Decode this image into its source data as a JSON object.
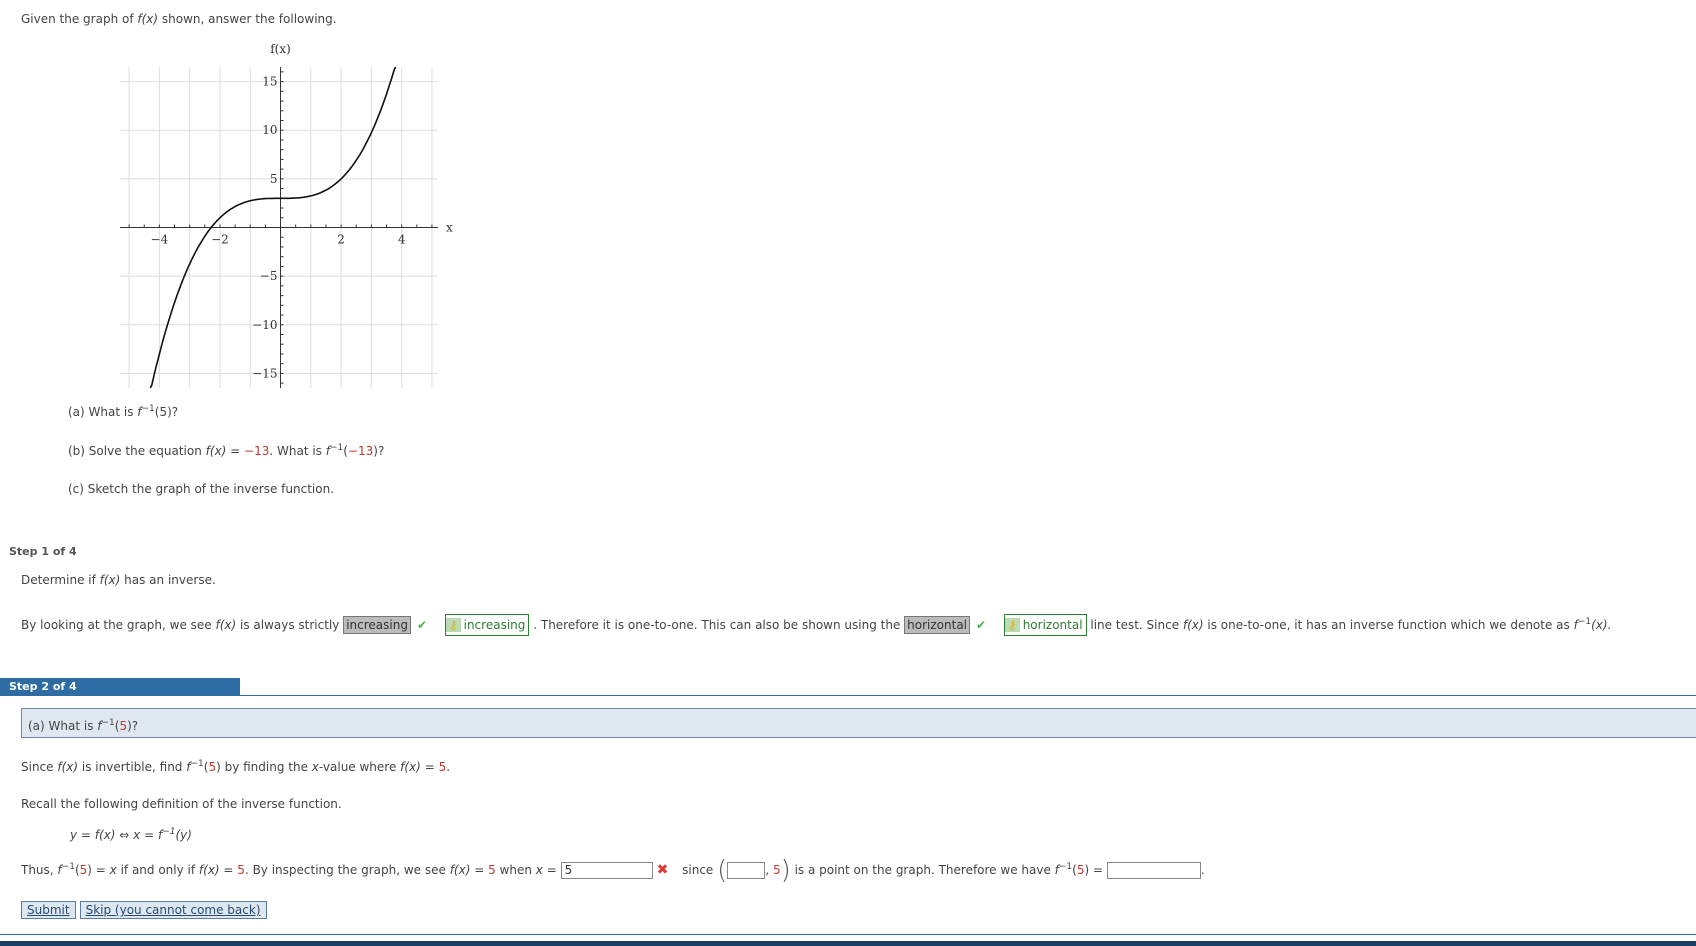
{
  "intro": {
    "pre": "Given the graph of ",
    "fx": "f(x)",
    "post": " shown, answer the following."
  },
  "chart_data": {
    "type": "line",
    "xlabel": "x",
    "ylabel": "f(x)",
    "xlim": [
      -5.3,
      5.2
    ],
    "ylim": [
      -16.5,
      16.5
    ],
    "x_ticks": [
      -4,
      -2,
      2,
      4
    ],
    "y_ticks": [
      -15,
      -10,
      -5,
      5,
      10,
      15
    ],
    "x_tick_labels": [
      "−4",
      "−2",
      "2",
      "4"
    ],
    "y_tick_labels": [
      "−15",
      "−10",
      "−5",
      "5",
      "10",
      "15"
    ],
    "grid": true,
    "series": [
      {
        "x": [
          -4.3,
          -4,
          -3,
          -2.3,
          -2,
          -1,
          0,
          1,
          2,
          3,
          3.8
        ],
        "y": [
          -16.9,
          -13,
          -3.75,
          0,
          1,
          2.75,
          3,
          3.25,
          5,
          9.75,
          16.7
        ]
      }
    ]
  },
  "questions": {
    "a": {
      "pre": "(a) What is ",
      "f": "f",
      "sup": "−1",
      "arg": "(5)?"
    },
    "b": {
      "pre": "(b) Solve the equation ",
      "fx": "f(x)",
      "eq": " = ",
      "val": "−13",
      "mid": ".  What is ",
      "f": "f",
      "sup": "−1",
      "arg_open": "(",
      "arg_val": "−13",
      "arg_close": ")?"
    },
    "c": {
      "text": "(c) Sketch the graph of the inverse function."
    }
  },
  "step1": {
    "label": "Step 1 of 4",
    "prompt_pre": "Determine if ",
    "prompt_fx": "f(x)",
    "prompt_post": " has an inverse.",
    "s_pre": "By looking at the graph, we see ",
    "s_fx": "f(x)",
    "s_mid": " is always strictly ",
    "answer1": "increasing",
    "key1": "increasing",
    "s_mid2": ". Therefore it is one-to-one. This can also be shown using the ",
    "answer2": "horizontal",
    "key2": "horizontal",
    "s_mid3": " line test. Since ",
    "s_fx2": "f(x)",
    "s_mid4": " is one-to-one, it has an inverse function which we denote as ",
    "s_f": "f",
    "s_sup": "−1",
    "s_end": "(x)."
  },
  "step2": {
    "label": "Step 2 of 4",
    "question": {
      "pre": "(a) What is ",
      "f": "f",
      "sup": "−1",
      "open": "(",
      "val": "5",
      "close": ")?"
    },
    "line1": {
      "pre": "Since ",
      "fx": "f(x)",
      "mid": " is invertible, find ",
      "f": "f",
      "sup": "−1",
      "open": "(",
      "val": "5",
      "close": ")",
      "mid2": " by finding the ",
      "x": "x",
      "mid3": "-value where ",
      "fx2": "f(x)",
      "eq": " = ",
      "val2": "5",
      "end": "."
    },
    "line2": "Recall the following definition of the inverse function.",
    "definition": {
      "lhs": "y = f(x)",
      "arrow": " ⇔ ",
      "rhs": "x = f",
      "sup": "−1",
      "end": "(y)"
    },
    "line3": {
      "pre": "Thus, ",
      "f": "f",
      "sup": "−1",
      "open": "(",
      "val": "5",
      "close": ")",
      "eqx": " = x",
      "mid": " if and only if ",
      "fx": "f(x)",
      "eq": " = ",
      "val2": "5",
      "mid2": ".  By inspecting the graph, we see ",
      "fx2": "f(x)",
      "eq2": " = ",
      "val3": "5",
      "mid3": " when ",
      "x": "x",
      "eq3": " = ",
      "input1_value": "5",
      "since": "since",
      "input2_value": "",
      "comma": ",",
      "pt_y": "5",
      "mid4": " is a point on the graph. Therefore we have ",
      "f2": "f",
      "sup2": "−1",
      "open2": "(",
      "val4": "5",
      "close2": ") = ",
      "input3_value": "",
      "end": "."
    },
    "submit": "Submit",
    "skip": "Skip (you cannot come back)"
  },
  "colors": {
    "accent": "#2e6da4",
    "highlight": "#c0392b",
    "correct": "#4caf50",
    "wrong": "#e53935"
  }
}
